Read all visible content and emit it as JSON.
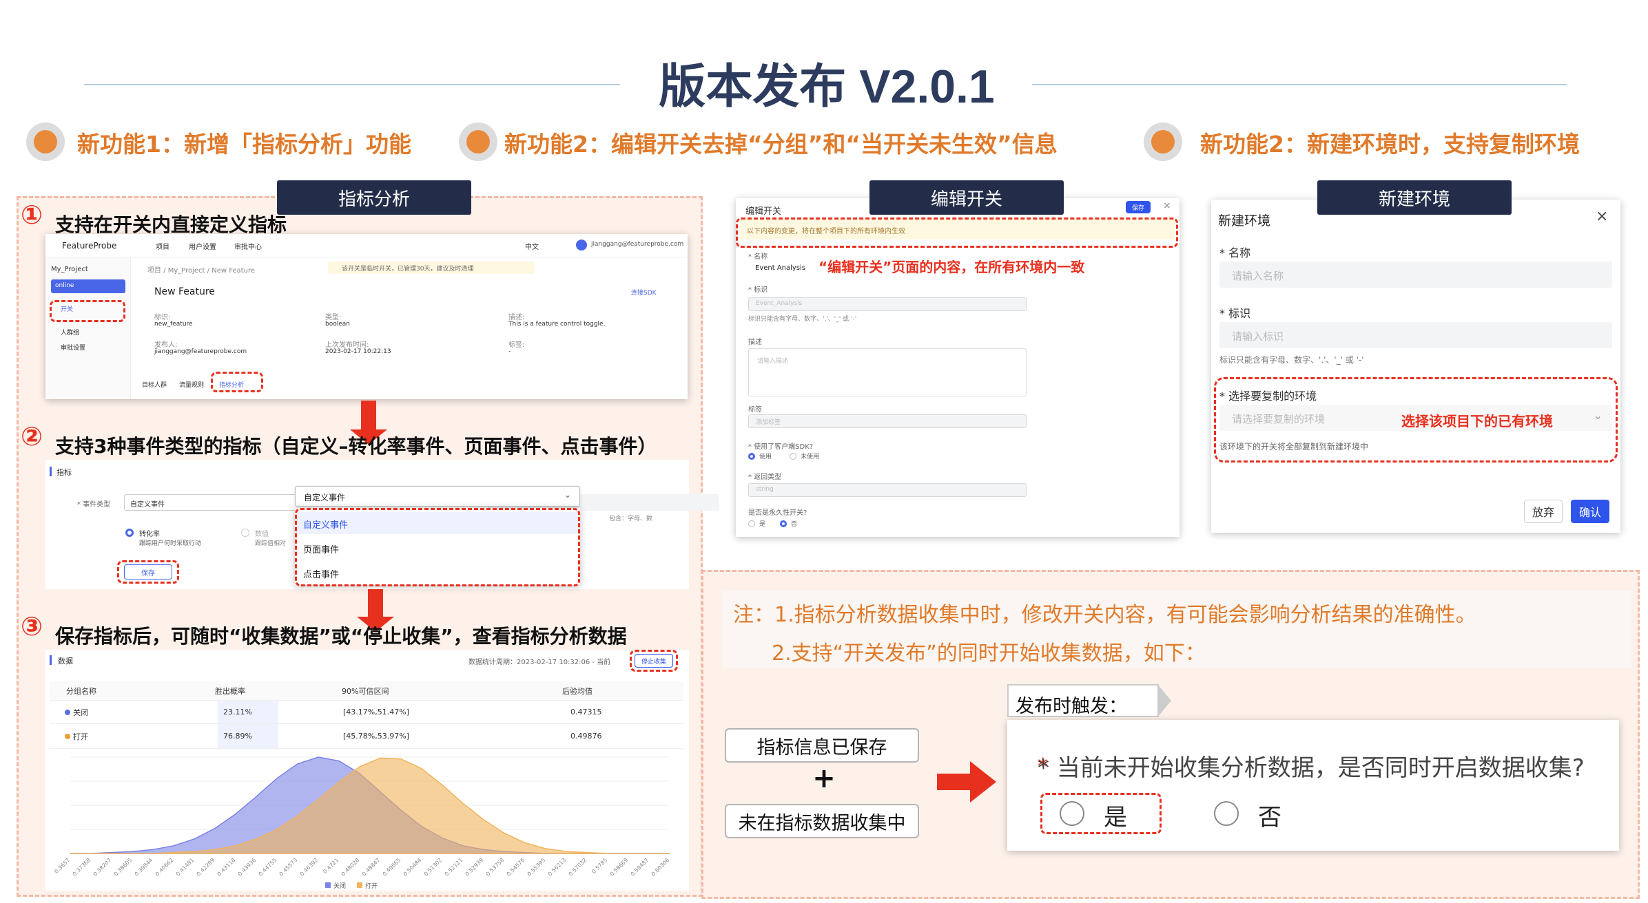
{
  "title": "版本发布 V2.0.1",
  "features": [
    "新功能1：新增「指标分析」功能",
    "新功能2：编辑开关去掉“分组”和“当开关未生效”信息",
    "新功能2：新建环境时，支持复制环境"
  ],
  "left_panel": {
    "tag": "指标分析",
    "step1": {
      "num": "①",
      "text": "支持在开关内直接定义指标"
    },
    "step2": {
      "num": "②",
      "text": "支持3种事件类型的指标（自定义–转化率事件、页面事件、点击事件）"
    },
    "step3": {
      "num": "③",
      "text": "保存指标后，可随时“收集数据”或“停止收集”，查看指标分析数据"
    },
    "app": {
      "logo": "FeatureProbe",
      "nav": [
        "项目",
        "用户设置",
        "审批中心"
      ],
      "lang": "中文",
      "user": "jianggang@featureprobe.com",
      "project": "My_Project",
      "env": "online",
      "side_items": [
        "开关",
        "人群组",
        "审批设置"
      ],
      "breadcrumb": "项目 / My_Project / New Feature",
      "notice": "该开关是临时开关，已管理30天，建议及时清理",
      "feature_title": "New Feature",
      "sdk_link": "连接SDK",
      "meta": [
        {
          "label": "标识:",
          "value": "new_feature"
        },
        {
          "label": "类型:",
          "value": "boolean"
        },
        {
          "label": "描述:",
          "value": "This is a feature control toggle."
        },
        {
          "label": "发布人:",
          "value": "jianggang@featureprobe.com"
        },
        {
          "label": "上次发布时间:",
          "value": "2023-02-17 10:22:13"
        },
        {
          "label": "标签:",
          "value": "-"
        }
      ],
      "tabs": [
        "目标人群",
        "流量规则",
        "指标分析"
      ]
    },
    "metric_form": {
      "section": "指标",
      "event_type_label": "* 事件类型",
      "event_type_value": "自定义事件",
      "radio1": "转化率",
      "radio1_desc": "跟踪用户何时采取行动",
      "radio2": "数值",
      "radio2_desc": "跟踪值相对",
      "hint_right": "包含：字母、数",
      "save": "保存",
      "dropdown_selected": "自定义事件",
      "dropdown_options": [
        "自定义事件",
        "页面事件",
        "点击事件"
      ]
    },
    "data_panel": {
      "section": "数据",
      "period": "数据统计周期：2023-02-17 10:32:06 - 当前",
      "stop_button": "停止收集",
      "headers": [
        "分组名称",
        "胜出概率",
        "90%可信区间",
        "后验均值"
      ],
      "rows": [
        {
          "name": "关闭",
          "color": "#5b6ee1",
          "prob": "23.11%",
          "ci": "[43.17%,51.47%]",
          "mean": "0.47315"
        },
        {
          "name": "打开",
          "color": "#f0a030",
          "prob": "76.89%",
          "ci": "[45.78%,53.97%]",
          "mean": "0.49876"
        }
      ]
    }
  },
  "chart_data": {
    "type": "area",
    "title": "",
    "x": [
      "0.3657",
      "0.37368",
      "0.38207",
      "0.38605",
      "0.39844",
      "0.40662",
      "0.41481",
      "0.42299",
      "0.43118",
      "0.43936",
      "0.44755",
      "0.45573",
      "0.46392",
      "0.4721",
      "0.48028",
      "0.48847",
      "0.49665",
      "0.50484",
      "0.51302",
      "0.52121",
      "0.52939",
      "0.53758",
      "0.54576",
      "0.55395",
      "0.56213",
      "0.57032",
      "0.5785",
      "0.58669",
      "0.59487",
      "0.60306"
    ],
    "series": [
      {
        "name": "关闭",
        "color": "#7b83e6",
        "values": [
          0.0,
          0.0,
          0.01,
          0.02,
          0.04,
          0.08,
          0.15,
          0.26,
          0.41,
          0.59,
          0.78,
          0.93,
          1.0,
          0.96,
          0.83,
          0.64,
          0.45,
          0.28,
          0.16,
          0.08,
          0.04,
          0.02,
          0.01,
          0.0,
          0.0,
          0.0,
          0.0,
          0.0,
          0.0,
          0.0
        ]
      },
      {
        "name": "打开",
        "color": "#f2b35a",
        "values": [
          0.0,
          0.0,
          0.0,
          0.0,
          0.0,
          0.01,
          0.02,
          0.04,
          0.08,
          0.15,
          0.25,
          0.39,
          0.56,
          0.74,
          0.9,
          0.99,
          0.98,
          0.88,
          0.71,
          0.52,
          0.35,
          0.21,
          0.11,
          0.05,
          0.02,
          0.01,
          0.0,
          0.0,
          0.0,
          0.0
        ]
      }
    ],
    "legend": "bottom"
  },
  "edit_panel": {
    "tag": "编辑开关",
    "window_title": "编辑开关",
    "save": "保存",
    "banner": "以下内容的变更，将在整个项目下的所有环境内生效",
    "name_label": "* 名称",
    "name_value": "Event Analysis",
    "annotation": "“编辑开关”页面的内容，在所有环境内一致",
    "key_label": "* 标识",
    "key_value": "Event_Analysis",
    "key_hint": "标识只能含有字母、数字、'.'、'_' 或 '-'",
    "desc_label": "描述",
    "desc_placeholder": "请输入描述",
    "tags_label": "标签",
    "tags_placeholder": "添加标签",
    "client_sdk_label": "* 使用了客户端SDK?",
    "client_sdk_options": [
      "使用",
      "未使用"
    ],
    "return_type_label": "* 返回类型",
    "return_type_value": "string",
    "permanent_label": "是否是永久性开关?",
    "permanent_options": [
      "是",
      "否"
    ]
  },
  "new_env_panel": {
    "tag": "新建环境",
    "window_title": "新建环境",
    "name_label": "* 名称",
    "name_placeholder": "请输入名称",
    "key_label": "* 标识",
    "key_placeholder": "请输入标识",
    "key_hint": "标识只能含有字母、数字、'.'、'_' 或 '-'",
    "copy_label": "* 选择要复制的环境",
    "copy_placeholder": "请选择要复制的环境",
    "copy_annotation": "选择该项目下的已有环境",
    "copy_hint": "该环境下的开关将全部复制到新建环境中",
    "cancel": "放弃",
    "confirm": "确认"
  },
  "notes": {
    "line1": "注：1.指标分析数据收集中时，修改开关内容，有可能会影响分析结果的准确性。",
    "line2": "2.支持“开关发布”的同时开始收集数据，如下：",
    "box1": "指标信息已保存",
    "plus": "+",
    "box2": "未在指标数据收集中",
    "trigger_label": "发布时触发：",
    "question": "* 当前未开始收集分析数据，是否同时开启数据收集?",
    "yes": "是",
    "no": "否"
  }
}
